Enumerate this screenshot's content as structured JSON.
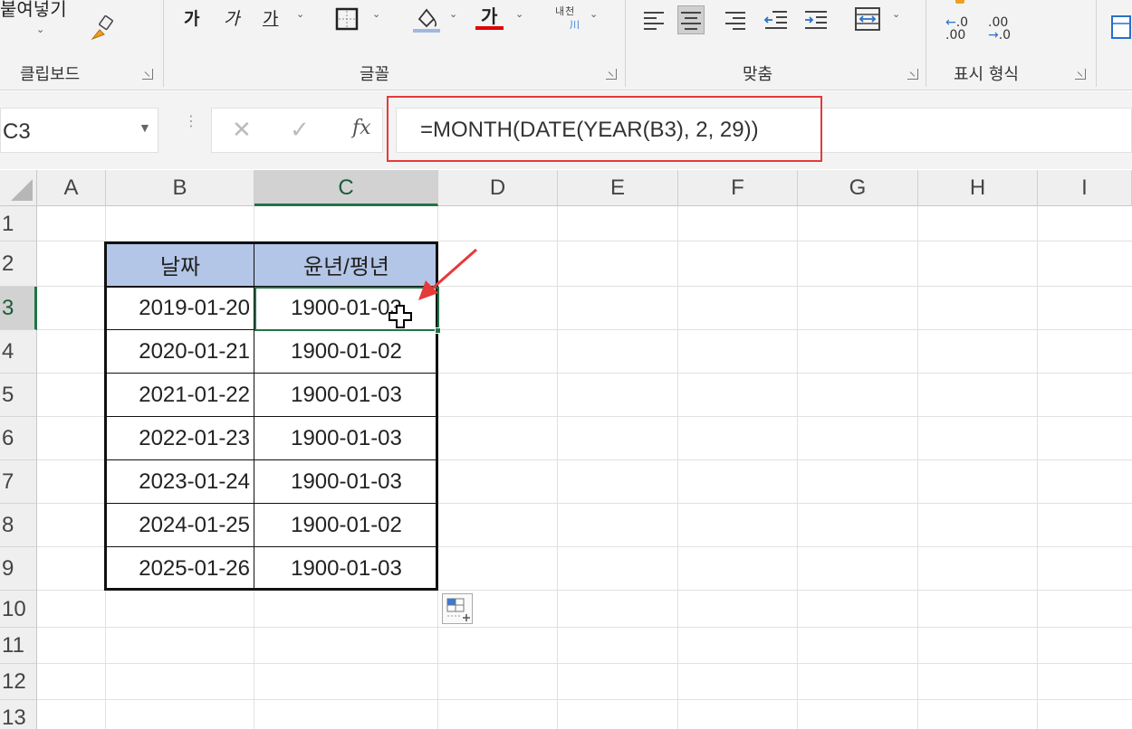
{
  "ribbon": {
    "clipboard": {
      "paste_label": "붙여넣기",
      "group_label": "클립보드"
    },
    "font": {
      "bold_glyph": "가",
      "italic_glyph": "가",
      "underline_glyph": "가",
      "font_color_glyph": "가",
      "wrap_glyph": "내천",
      "group_label": "글꼴",
      "fill_color": "#9fb8e0",
      "font_color": "#e00000"
    },
    "alignment": {
      "group_label": "맞춤"
    },
    "number": {
      "group_label": "표시 형식",
      "inc_decimal_top": ".0",
      "inc_decimal_bottom": ".00",
      "dec_decimal_top": ".00",
      "dec_decimal_bottom": ".0"
    }
  },
  "formula_bar": {
    "name_box": "C3",
    "fx_label": "fx",
    "formula": "=MONTH(DATE(YEAR(B3), 2, 29))"
  },
  "columns": [
    "A",
    "B",
    "C",
    "D",
    "E",
    "F",
    "G",
    "H",
    "I"
  ],
  "rows": [
    "1",
    "2",
    "3",
    "4",
    "5",
    "6",
    "7",
    "8",
    "9",
    "10",
    "11",
    "12",
    "13"
  ],
  "table": {
    "headers": [
      "날짜",
      "윤년/평년"
    ],
    "rows": [
      [
        "2019-01-20",
        "1900-01-03"
      ],
      [
        "2020-01-21",
        "1900-01-02"
      ],
      [
        "2021-01-22",
        "1900-01-03"
      ],
      [
        "2022-01-23",
        "1900-01-03"
      ],
      [
        "2023-01-24",
        "1900-01-03"
      ],
      [
        "2024-01-25",
        "1900-01-02"
      ],
      [
        "2025-01-26",
        "1900-01-03"
      ]
    ]
  },
  "colors": {
    "accent": "#217346",
    "annotation": "#e53a3a",
    "header_fill": "#b4c6e7"
  }
}
